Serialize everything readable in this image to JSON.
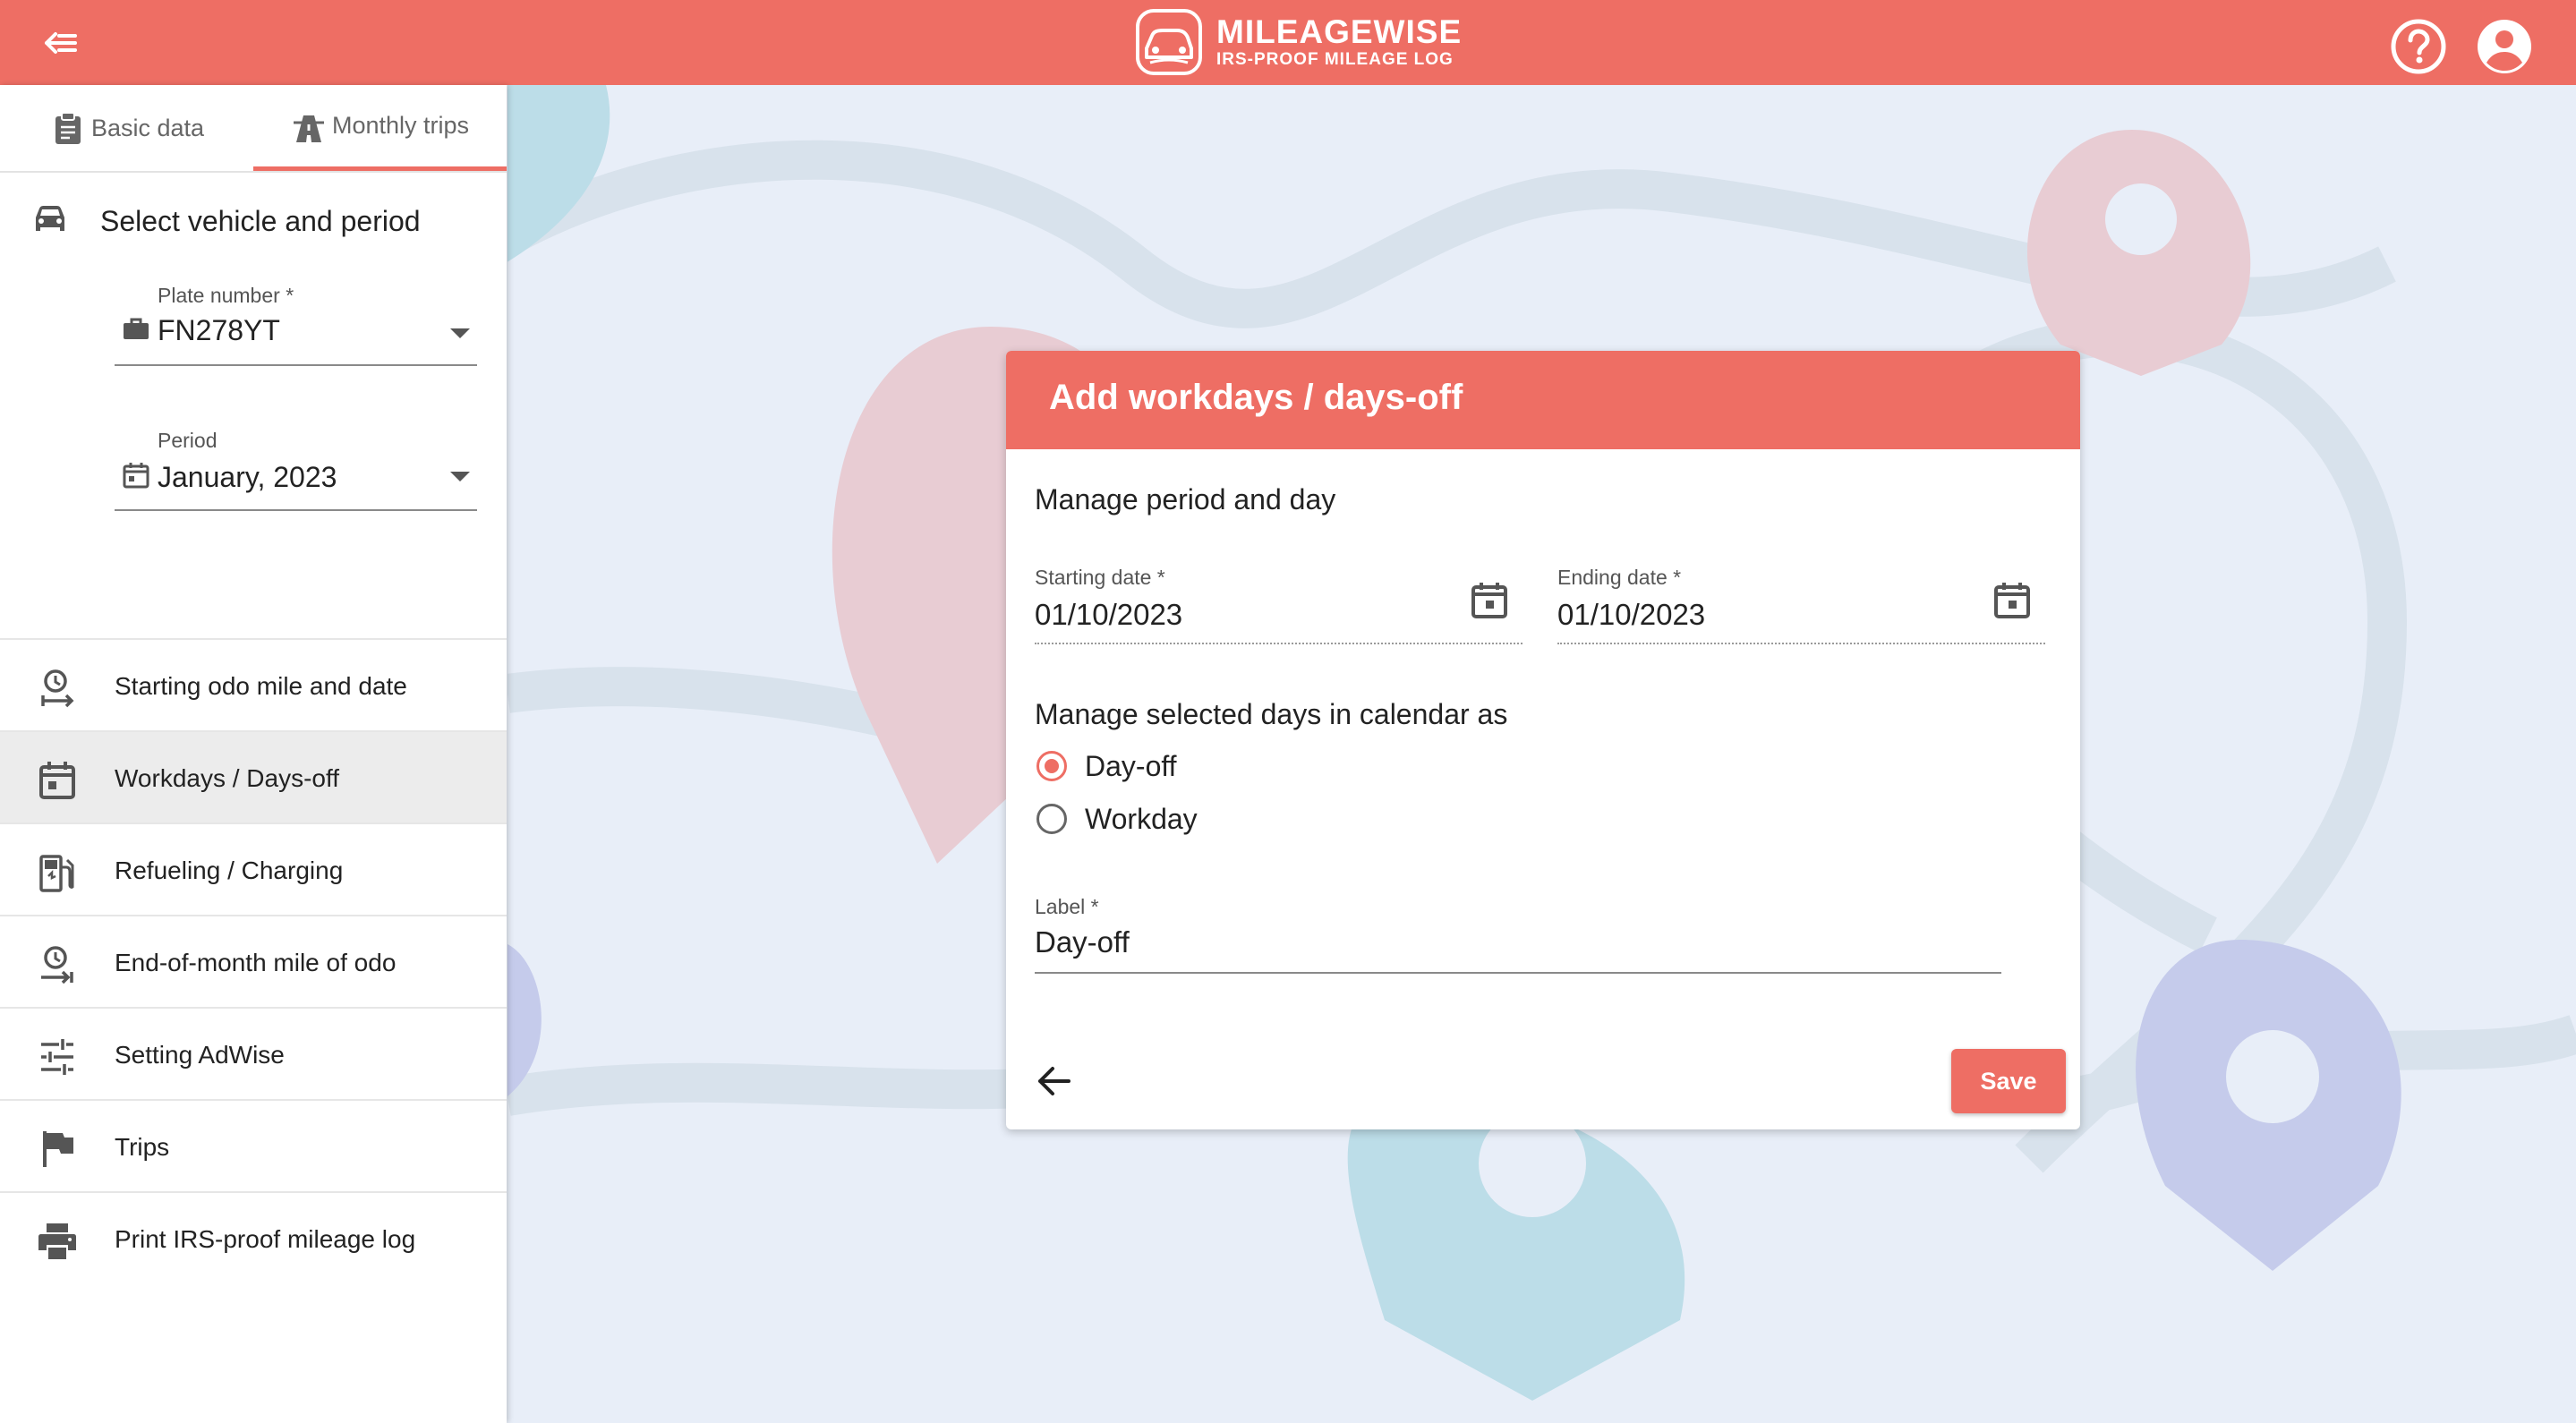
{
  "header": {
    "brand_name": "MILEAGEWISE",
    "brand_tagline": "IRS-PROOF MILEAGE LOG"
  },
  "tabs": [
    {
      "label": "Basic data"
    },
    {
      "label": "Monthly trips"
    }
  ],
  "sidebar": {
    "section_title": "Select vehicle and period",
    "plate": {
      "label": "Plate number *",
      "value": "FN278YT"
    },
    "period": {
      "label": "Period",
      "value": "January, 2023"
    },
    "items": [
      {
        "label": "Starting odo mile and date"
      },
      {
        "label": "Workdays / Days-off"
      },
      {
        "label": "Refueling / Charging"
      },
      {
        "label": "End-of-month mile of odo"
      },
      {
        "label": "Setting AdWise"
      },
      {
        "label": "Trips"
      },
      {
        "label": "Print IRS-proof mileage log"
      }
    ]
  },
  "dialog": {
    "title": "Add workdays / days-off",
    "subtitle": "Manage period and day",
    "start": {
      "label": "Starting date *",
      "value": "01/10/2023"
    },
    "end": {
      "label": "Ending date *",
      "value": "01/10/2023"
    },
    "manage_label": "Manage selected days in calendar as",
    "options": [
      {
        "label": "Day-off",
        "selected": true
      },
      {
        "label": "Workday",
        "selected": false
      }
    ],
    "label_field": {
      "label": "Label *",
      "value": "Day-off"
    },
    "save_label": "Save"
  },
  "colors": {
    "accent": "#ee6e64",
    "background": "#e8eef8"
  }
}
